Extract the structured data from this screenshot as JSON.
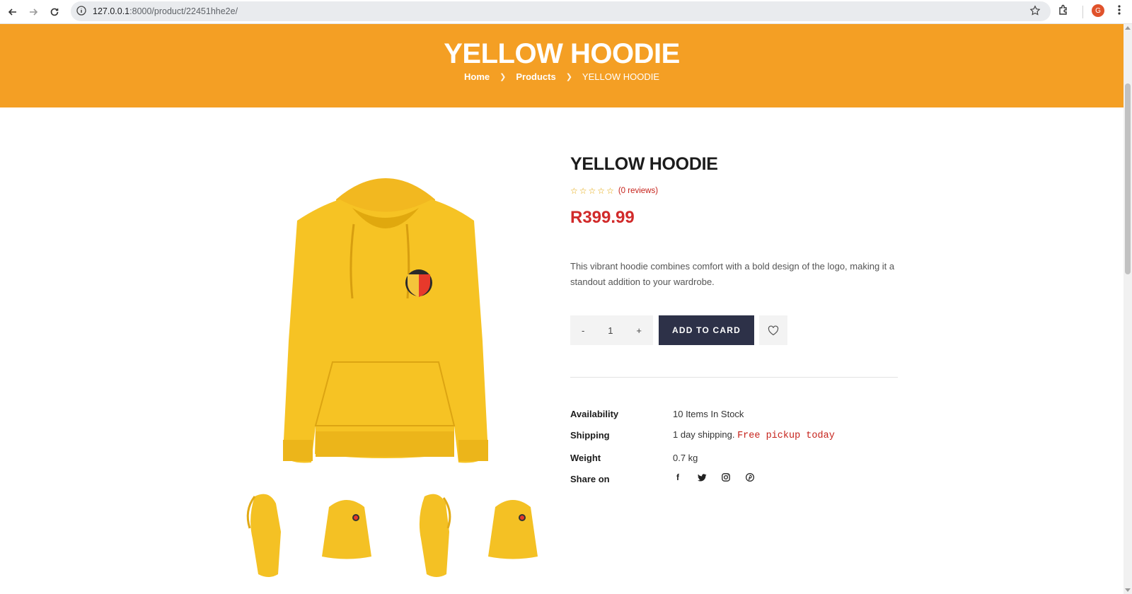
{
  "browser": {
    "url_host": "127.0.0.1",
    "url_rest": ":8000/product/22451hhe2e/",
    "profile_initial": "G"
  },
  "hero": {
    "title": "YELLOW HOODIE",
    "breadcrumb": [
      "Home",
      "Products",
      "YELLOW HOODIE"
    ]
  },
  "product": {
    "title": "YELLOW HOODIE",
    "rating_stars": 0,
    "reviews_label": "(0 reviews)",
    "price": "R399.99",
    "description": "This vibrant hoodie combines comfort with a bold design of the logo, making it a standout addition to your wardrobe.",
    "quantity": "1",
    "minus": "-",
    "plus": "+",
    "add_to_cart_label": "ADD TO CARD",
    "meta": {
      "availability_label": "Availability",
      "availability_value": "10 Items In Stock",
      "shipping_label": "Shipping",
      "shipping_value": "1 day shipping.",
      "shipping_highlight": "Free pickup today",
      "weight_label": "Weight",
      "weight_value": "0.7 kg",
      "share_label": "Share on"
    },
    "socials": [
      "facebook-icon",
      "twitter-icon",
      "instagram-icon",
      "pinterest-icon"
    ],
    "colors": {
      "accent": "#f49f24",
      "price": "#d12a2a",
      "button": "#2d3148",
      "hoodie": "#f6c324"
    }
  }
}
